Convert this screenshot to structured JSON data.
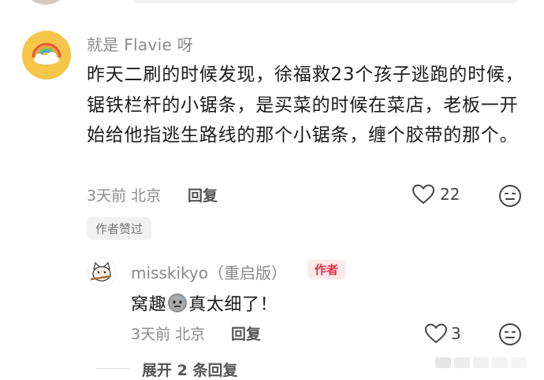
{
  "comment": {
    "username": "就是 Flavie 呀",
    "content": "昨天二刷的时候发现，徐福救23个孩子逃跑的时候，锯铁栏杆的小锯条，是买菜的时候在菜店，老板一开始给他指逃生路线的那个小锯条，缠个胶带的那个。",
    "meta": "3天前 北京",
    "reply_label": "回复",
    "like_count": "22",
    "author_liked_label": "作者赞过",
    "avatar_icon": "rainbow-cloud-avatar"
  },
  "reply": {
    "username": "misskikyo（重启版）",
    "author_tag": "作者",
    "content_before": "窝趣",
    "content_after": "真太细了！",
    "emoji_icon": "sweat-emoji",
    "meta": "3天前 北京",
    "reply_label": "回复",
    "like_count": "3"
  },
  "expand_label": "展开 2 条回复",
  "colors": {
    "author_tag_bg": "#fde8ea",
    "author_tag_text": "#e0334a",
    "avatar_bg": "#f6c64a"
  }
}
